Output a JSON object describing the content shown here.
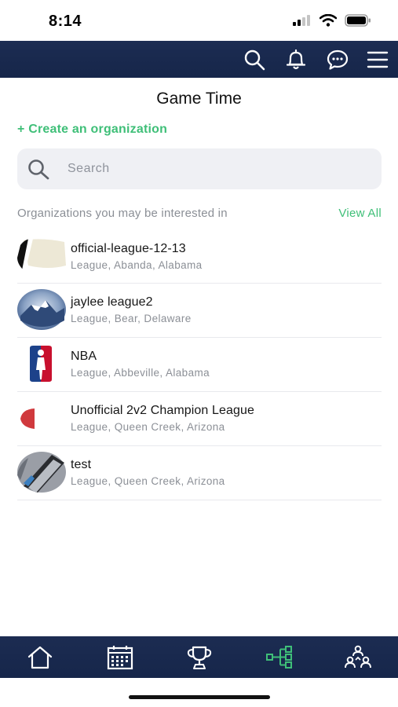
{
  "status_bar": {
    "time": "8:14",
    "icons": [
      "signal-icon",
      "wifi-icon",
      "battery-icon"
    ]
  },
  "top_nav": {
    "icons": [
      "search-icon",
      "bell-icon",
      "chat-icon",
      "menu-icon"
    ],
    "background_color": "#1c2c52"
  },
  "page": {
    "title": "Game Time",
    "create_link": "+ Create an organization"
  },
  "search": {
    "placeholder": "Search",
    "value": ""
  },
  "section": {
    "title": "Organizations you may be interested in",
    "view_all": "View All"
  },
  "organizations": [
    {
      "name": "official-league-12-13",
      "subtitle": "League, Abanda, Alabama"
    },
    {
      "name": "jaylee league2",
      "subtitle": "League, Bear, Delaware"
    },
    {
      "name": "NBA",
      "subtitle": "League, Abbeville, Alabama"
    },
    {
      "name": "Unofficial 2v2 Champion League",
      "subtitle": "League, Queen Creek, Arizona"
    },
    {
      "name": "test",
      "subtitle": "League, Queen Creek, Arizona"
    }
  ],
  "bottom_nav": {
    "tabs": [
      "home-icon",
      "calendar-icon",
      "trophy-icon",
      "organization-tree-icon",
      "people-icon"
    ],
    "active_tab": "organization-tree-icon",
    "accent_color": "#3fbf78"
  }
}
